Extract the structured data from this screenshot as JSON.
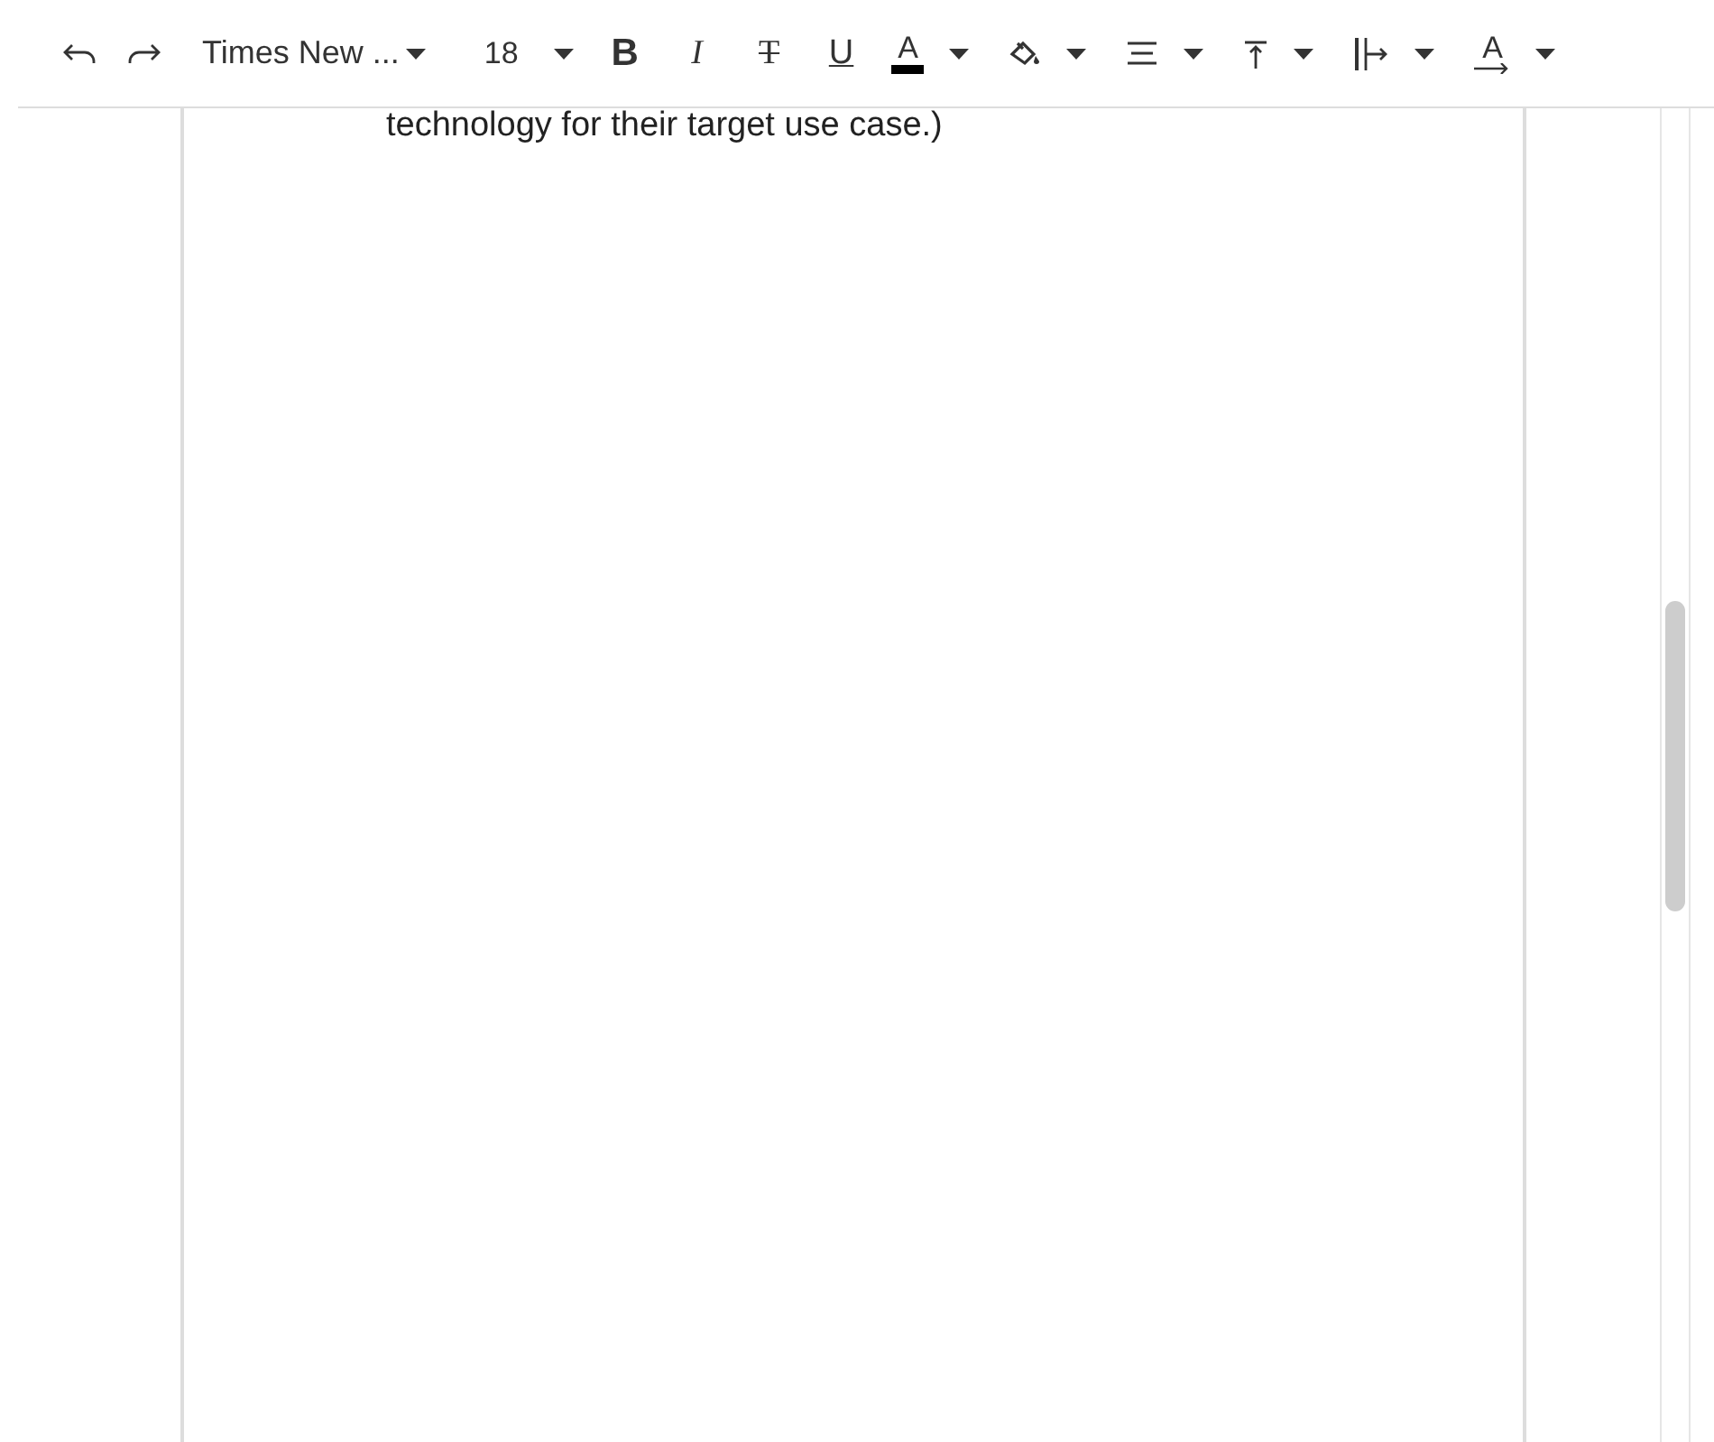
{
  "toolbar": {
    "font_family": "Times New ...",
    "font_size": "18",
    "format_buttons": [
      {
        "kind": "bold",
        "label": "B"
      },
      {
        "kind": "italic",
        "label": "I"
      },
      {
        "kind": "strike",
        "label": "T"
      },
      {
        "kind": "underline",
        "label": "U"
      }
    ],
    "font_color": {
      "label": "A",
      "color": "#000000"
    },
    "menus": [
      {
        "kind": "fill"
      },
      {
        "kind": "align"
      },
      {
        "kind": "valign"
      },
      {
        "kind": "indent"
      },
      {
        "kind": "rotate",
        "label": "A"
      }
    ]
  },
  "document": {
    "text": "technology for their target use case.)"
  }
}
